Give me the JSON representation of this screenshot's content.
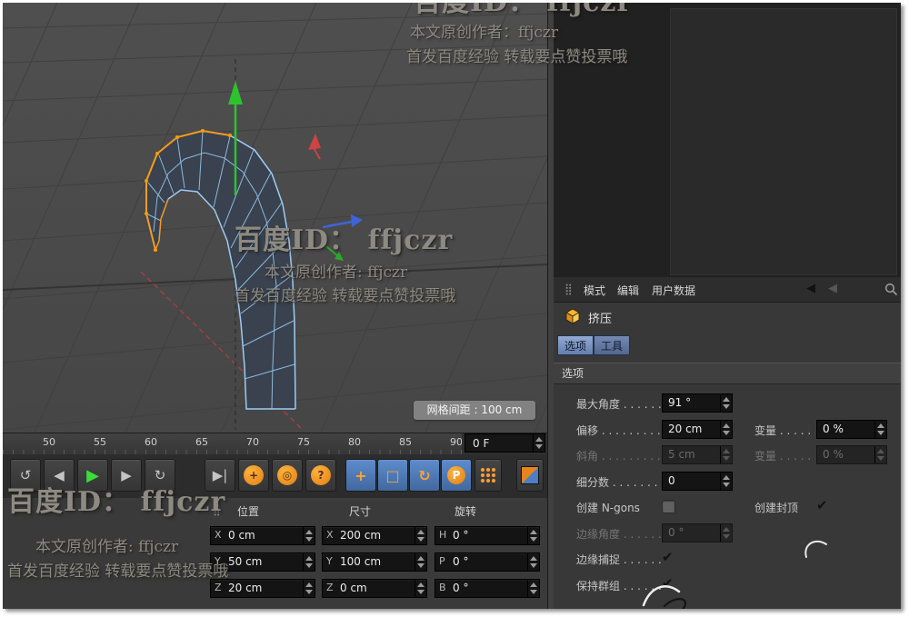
{
  "watermark": {
    "id_line": "百度ID： ffjczr",
    "author_line": "本文原创作者: ffjczr",
    "author_line_fw": "本文原创作者：ffjczr",
    "footer_line": "首发百度经验 转载要点赞投票哦"
  },
  "viewport": {
    "grid_spacing": "网格间距 : 100 cm"
  },
  "timeline": {
    "ticks": [
      "50",
      "55",
      "60",
      "65",
      "70",
      "75",
      "80",
      "85",
      "90"
    ],
    "frame": "0 F"
  },
  "transport": {
    "goto_start": "↺",
    "prev_key": "◀",
    "play": "▶",
    "next_key": "▶",
    "loop": "↻",
    "goto_end": "▶|",
    "record_dot": "+",
    "record_ring": "◎",
    "record_help": "?",
    "move": "+",
    "scale": "□",
    "rotate": "↻",
    "parent": "P"
  },
  "icons": {
    "attr_grid": "⣿",
    "coord_grid": "⣿",
    "back_arrow": "◀",
    "back_arrow2": "◀"
  },
  "coords": {
    "headers": {
      "position": "位置",
      "size": "尺寸",
      "rotation": "旋转"
    },
    "position": {
      "x": {
        "axis": "X",
        "value": "0 cm"
      },
      "y": {
        "axis": "Y",
        "value": "50 cm"
      },
      "z": {
        "axis": "Z",
        "value": "20 cm"
      }
    },
    "size": {
      "x": {
        "axis": "X",
        "value": "200 cm"
      },
      "y": {
        "axis": "Y",
        "value": "100 cm"
      },
      "z": {
        "axis": "Z",
        "value": "0 cm"
      }
    },
    "rotation": {
      "h": {
        "axis": "H",
        "value": "0 °"
      },
      "p": {
        "axis": "P",
        "value": "0 °"
      },
      "b": {
        "axis": "B",
        "value": "0 °"
      }
    }
  },
  "attributes": {
    "menu": {
      "mode": "模式",
      "edit": "编辑",
      "user_data": "用户数据"
    },
    "object_label": "挤压",
    "tabs": {
      "options": "选项",
      "tool": "工具"
    },
    "section_title": "选项",
    "fields": {
      "max_angle": {
        "label": "最大角度 . . . . . .",
        "value": "91 °"
      },
      "offset": {
        "label": "偏移 . . . . . . . . . .",
        "value": "20 cm"
      },
      "variation1": {
        "label": "变量 . . . . .",
        "value": "0 %"
      },
      "bevel": {
        "label": "斜角 . . . . . . . . . .",
        "value": "5 cm"
      },
      "variation2": {
        "label": "变量 . . . . .",
        "value": "0 %"
      },
      "subdivision": {
        "label": "细分数 . . . . . . . .",
        "value": "0"
      },
      "ngons_label": "创建 N-gons",
      "caps_label": "创建封顶",
      "edge_angle": {
        "label": "边缘角度 . . . . . .",
        "value": "0 °"
      },
      "edge_snap_label": "边缘捕捉 . . . . . .",
      "keep_groups_label": "保持群组 . . . . . .",
      "check_glyph": "✔"
    }
  }
}
